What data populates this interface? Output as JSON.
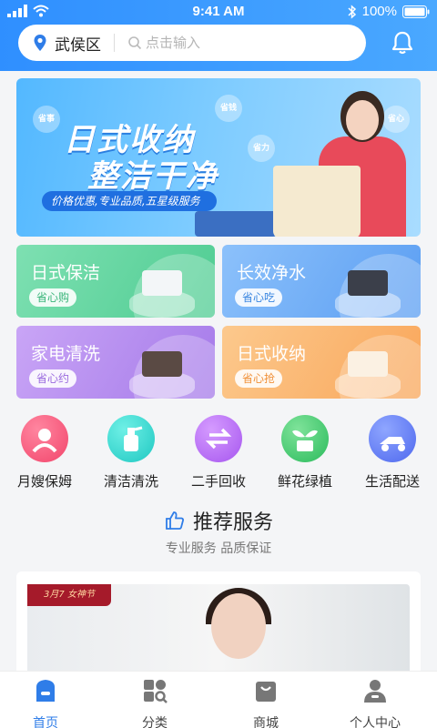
{
  "status_bar": {
    "time": "9:41 AM",
    "battery": "100%"
  },
  "header": {
    "location": "武侯区",
    "search_placeholder": "点击输入"
  },
  "banner": {
    "line1": "日式收纳",
    "line2": "整洁干净",
    "subtitle": "价格优惠,专业品质,五星级服务",
    "tags": [
      "省事",
      "省钱",
      "省力",
      "省心"
    ]
  },
  "services": [
    {
      "title": "日式保洁",
      "pill": "省心购",
      "color": "#5ad39a",
      "pill_color": "#3ab57a"
    },
    {
      "title": "长效净水",
      "pill": "省心吃",
      "color": "#5ea6f5",
      "pill_color": "#3a86e0"
    },
    {
      "title": "家电清洗",
      "pill": "省心约",
      "color": "#b68cf0",
      "pill_color": "#9a6ade"
    },
    {
      "title": "日式收纳",
      "pill": "省心抢",
      "color": "#fbb36a",
      "pill_color": "#f0913a"
    }
  ],
  "icons": [
    {
      "label": "月嫂保姆",
      "color": "#f2557a",
      "icon": "nanny-icon"
    },
    {
      "label": "清洁清洗",
      "color": "#2fd6cf",
      "icon": "cleaning-icon"
    },
    {
      "label": "二手回收",
      "color": "#b56cf2",
      "icon": "recycle-icon"
    },
    {
      "label": "鲜花绿植",
      "color": "#39c56a",
      "icon": "plant-icon"
    },
    {
      "label": "生活配送",
      "color": "#5b78f2",
      "icon": "delivery-icon"
    }
  ],
  "recommend": {
    "title": "推荐服务",
    "subtitle": "专业服务 品质保证",
    "card_badge": "3月7 女神节"
  },
  "tabs": [
    {
      "label": "首页",
      "active": true
    },
    {
      "label": "分类",
      "active": false
    },
    {
      "label": "商城",
      "active": false
    },
    {
      "label": "个人中心",
      "active": false
    }
  ],
  "colors": {
    "primary": "#2f8fff",
    "active_tab": "#2f7de8"
  }
}
